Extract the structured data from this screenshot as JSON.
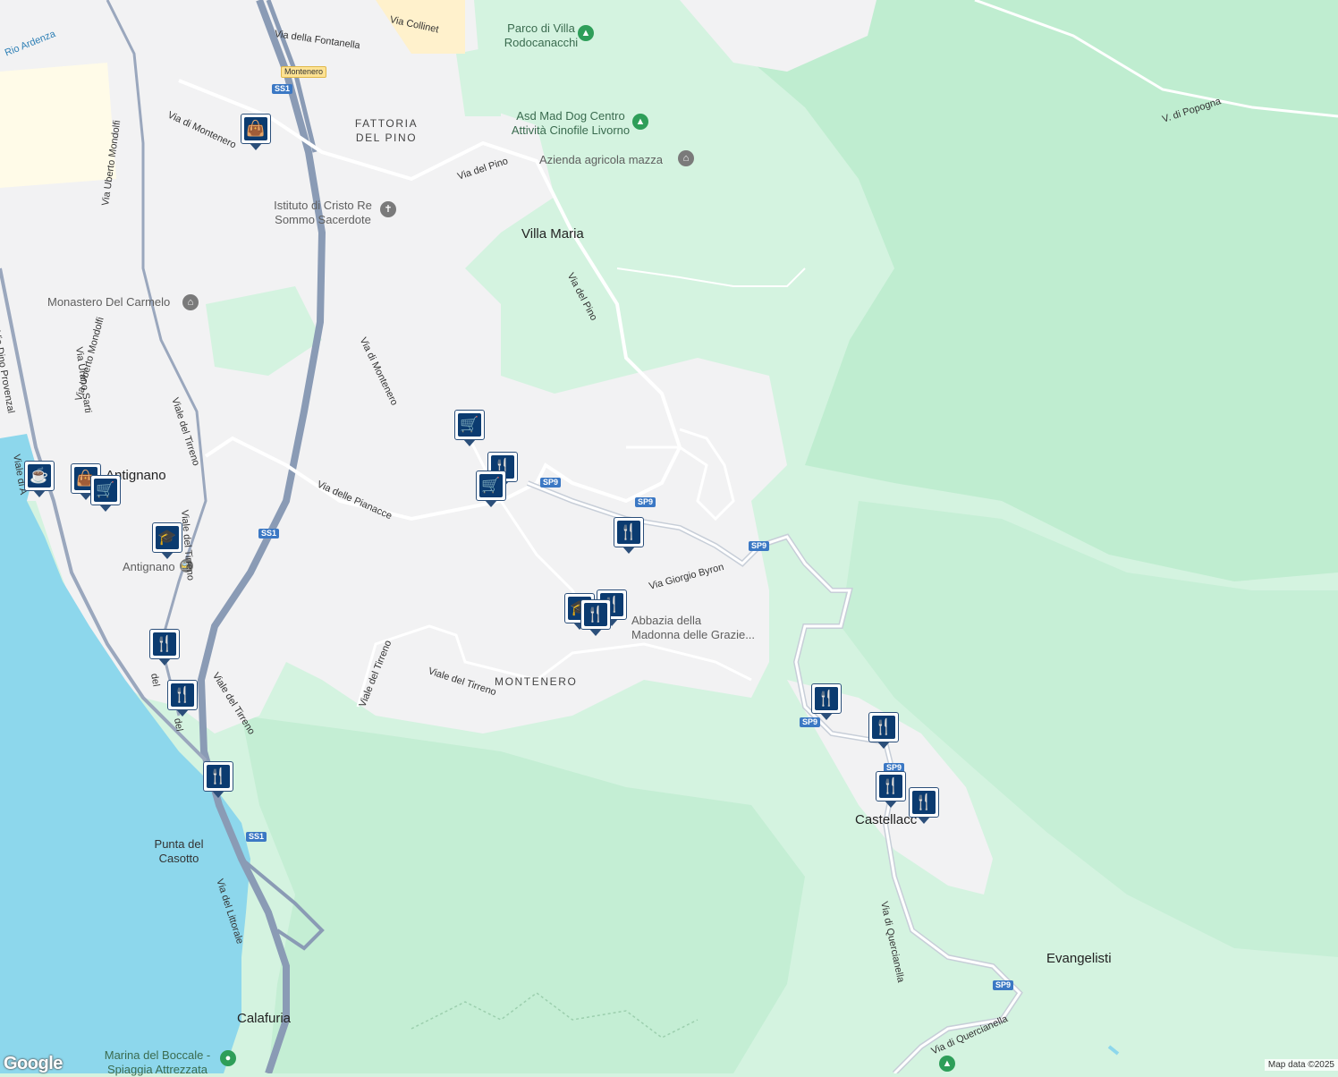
{
  "colors": {
    "sea": "#8dd7ec",
    "urban": "#f2f2f3",
    "park": "#d4f3e0",
    "forest": "#bfedd0",
    "highway": "#8a9bb5",
    "road": "#ffffff",
    "marker_fill": "#0b3b70",
    "shield_blue": "#3b78c4"
  },
  "places": {
    "villa_maria": "Villa Maria",
    "antignano": "Antignano",
    "calafuria": "Calafuria",
    "castellaccio": "Castellacc",
    "evangelisti": "Evangelisti",
    "fattoria_line1": "FATTORIA",
    "fattoria_line2": "DEL PINO",
    "montenero": "MONTENERO",
    "punta_line1": "Punta del",
    "punta_line2": "Casotto"
  },
  "pois": {
    "parco_line1": "Parco di Villa",
    "parco_line2": "Rodocanacchi",
    "asd_line1": "Asd Mad Dog Centro",
    "asd_line2": "Attività Cinofile Livorno",
    "azienda": "Azienda agricola mazza",
    "istituto_line1": "Istituto di Cristo Re",
    "istituto_line2": "Sommo Sacerdote",
    "monastero": "Monastero Del Carmelo",
    "abbazia_line1": "Abbazia della",
    "abbazia_line2": "Madonna delle Grazie...",
    "antignano_station": "Antignano",
    "marina_line1": "Marina del Boccale -",
    "marina_line2": "Spiaggia Attrezzata"
  },
  "roads": {
    "collinet": "Via Collinet",
    "fontanella": "Via della Fontanella",
    "montenero_a": "Via di Montenero",
    "montenero_b": "Via di Montenero",
    "uberto_a": "Via Uberto Mondolfi",
    "uberto_b": "Via Uberto Mondolfi",
    "del_pino_a": "Via del Pino",
    "del_pino_b": "Via del Pino",
    "popogna": "V. di Popogna",
    "dino": "Via Dino Provenzal",
    "urano": "Via Urano Sarti",
    "tirreno_a": "Viale del Tirreno",
    "tirreno_b": "Viale del Tirreno",
    "tirreno_c": "Viale del Tirreno",
    "tirreno_d": "Viale del Tirreno",
    "tirreno_e": "Viale del Tirreno",
    "pianacce": "Via delle Pianacce",
    "byron": "Via Giorgio Byron",
    "littorale": "Via del Littorale",
    "quercianella_a": "Via di Quercianella",
    "quercianella_b": "Via di Quercianella",
    "ardenza": "Rio Ardenza",
    "viale_a": "Viale di A",
    "del_a": "del",
    "del_b": "del"
  },
  "shields": {
    "ss1": "SS1",
    "sp9": "SP9",
    "montenero_tag": "Montenero"
  },
  "marker_icons": {
    "restaurant": "restaurant-icon",
    "shopping_cart": "shopping-cart-icon",
    "shopping_bag": "shopping-bag-icon",
    "cafe": "cafe-icon",
    "school": "school-icon"
  },
  "footer": {
    "google": "Google",
    "copyright": "Map data ©2025"
  }
}
